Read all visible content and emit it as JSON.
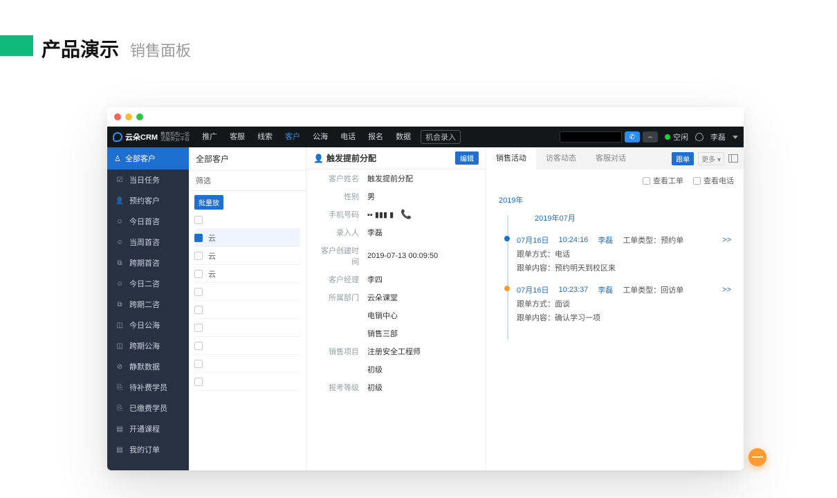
{
  "slide": {
    "title": "产品演示",
    "subtitle": "销售面板"
  },
  "logo": {
    "brand": "云朵CRM",
    "tag1": "教育机构一站",
    "tag2": "式服务云平台"
  },
  "nav": {
    "items": [
      "推广",
      "客服",
      "线索",
      "客户",
      "公海",
      "电话",
      "报名",
      "数据"
    ],
    "active_index": 3,
    "chip": "机会录入",
    "status": "空闲",
    "user": "李磊"
  },
  "sidebar": {
    "header": "全部客户",
    "items": [
      {
        "icon": "☑",
        "label": "当日任务"
      },
      {
        "icon": "👤",
        "label": "预约客户"
      },
      {
        "icon": "☺",
        "label": "今日首咨"
      },
      {
        "icon": "☺",
        "label": "当周首咨"
      },
      {
        "icon": "⧉",
        "label": "跨期首咨"
      },
      {
        "icon": "☺",
        "label": "今日二咨"
      },
      {
        "icon": "⧉",
        "label": "跨期二咨"
      },
      {
        "icon": "◫",
        "label": "今日公海"
      },
      {
        "icon": "◫",
        "label": "跨期公海"
      },
      {
        "icon": "⊘",
        "label": "静默数据"
      },
      {
        "icon": "⎘",
        "label": "待补费学员"
      },
      {
        "icon": "⎘",
        "label": "已缴费学员"
      },
      {
        "icon": "▤",
        "label": "开通课程"
      },
      {
        "icon": "▤",
        "label": "我的订单"
      }
    ]
  },
  "list": {
    "header": "全部客户",
    "filter_label": "筛选",
    "bulk_button": "批量放",
    "rows": [
      "",
      "云",
      "云",
      "云",
      "",
      "",
      "",
      "",
      "",
      ""
    ],
    "selected_index": 1
  },
  "detail": {
    "title": "触发提前分配",
    "edit": "编辑",
    "fields": [
      {
        "k": "客户姓名",
        "v": "触发提前分配"
      },
      {
        "k": "性别",
        "v": "男"
      },
      {
        "k": "手机号码",
        "v": "▪▪ ▮▮▮ ▮",
        "phone": true
      },
      {
        "k": "录入人",
        "v": "李磊"
      },
      {
        "k": "客户创建时间",
        "v": "2019-07-13 00:09:50"
      },
      {
        "k": "客户经理",
        "v": "李四"
      },
      {
        "k": "所属部门",
        "v": "云朵课堂"
      },
      {
        "k": "",
        "v": "电销中心"
      },
      {
        "k": "",
        "v": "销售三部"
      },
      {
        "k": "销售项目",
        "v": "注册安全工程师"
      },
      {
        "k": "",
        "v": "初级"
      },
      {
        "k": "报考等级",
        "v": "初级"
      }
    ]
  },
  "activity": {
    "tabs": [
      "销售活动",
      "访客动态",
      "客服对话"
    ],
    "active_tab": 0,
    "follow_label": "跟单",
    "more_label": "更多",
    "opt_ticket": "查看工单",
    "opt_call": "查看电话",
    "year": "2019年",
    "month": "2019年07月",
    "items": [
      {
        "date": "07月16日",
        "time": "10:24:16",
        "user": "李磊",
        "type": "工单类型：预约单",
        "link": ">>",
        "lines": [
          "跟单方式：电话",
          "跟单内容：预约明天到校区来"
        ]
      },
      {
        "date": "07月16日",
        "time": "10:23:37",
        "user": "李磊",
        "type": "工单类型：回访单",
        "link": ">>",
        "lines": [
          "跟单方式：面谈",
          "跟单内容：确认学习一项"
        ]
      }
    ]
  },
  "fab": "—"
}
